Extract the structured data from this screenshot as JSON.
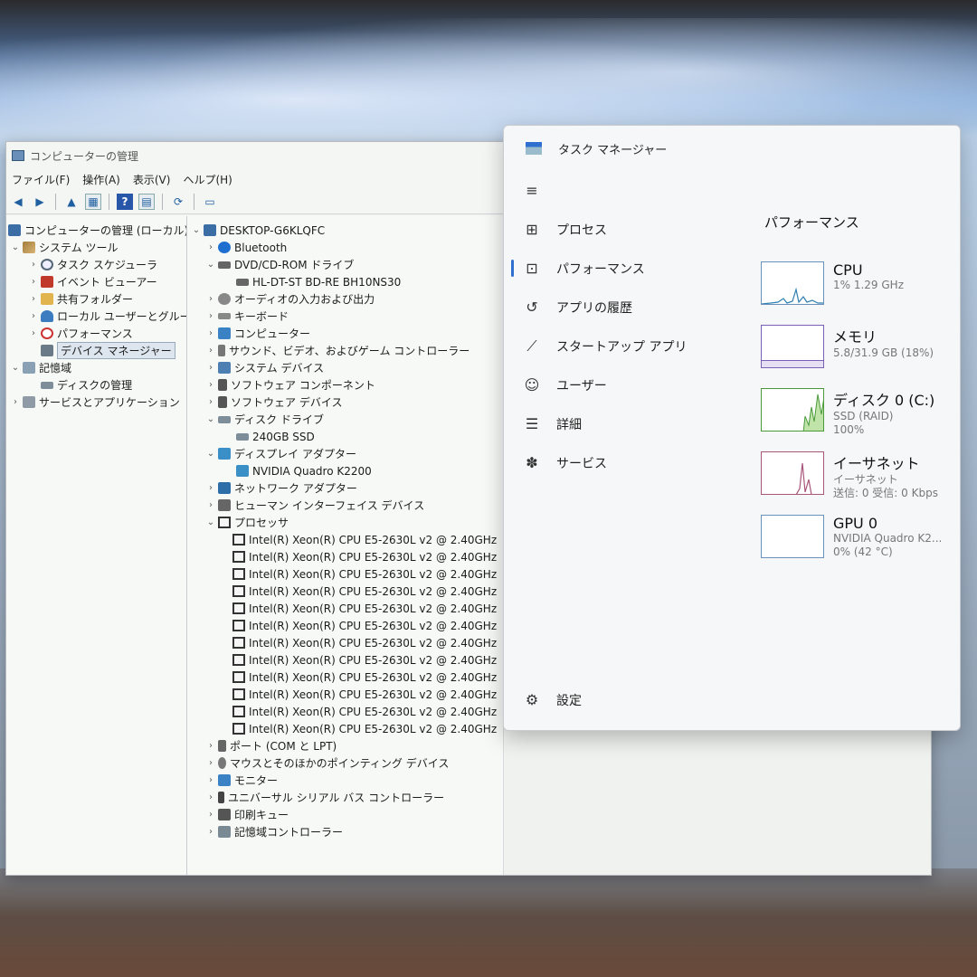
{
  "computer_management": {
    "title": "コンピューターの管理",
    "menu": [
      "ファイル(F)",
      "操作(A)",
      "表示(V)",
      "ヘルプ(H)"
    ],
    "tree": {
      "root": "コンピューターの管理 (ローカル)",
      "system_tools": "システム ツール",
      "task_scheduler": "タスク スケジューラ",
      "event_viewer": "イベント ビューアー",
      "shared_folders": "共有フォルダー",
      "local_users": "ローカル ユーザーとグループ",
      "performance": "パフォーマンス",
      "device_manager": "デバイス マネージャー",
      "storage": "記憶域",
      "disk_management": "ディスクの管理",
      "services_apps": "サービスとアプリケーション"
    },
    "devices": {
      "computer_name": "DESKTOP-G6KLQFC",
      "bluetooth": "Bluetooth",
      "dvd": "DVD/CD-ROM ドライブ",
      "dvd_child": "HL-DT-ST BD-RE  BH10NS30",
      "audio_io": "オーディオの入力および出力",
      "keyboard": "キーボード",
      "computer": "コンピューター",
      "sound": "サウンド、ビデオ、およびゲーム コントローラー",
      "system_devices": "システム デバイス",
      "software_components": "ソフトウェア コンポーネント",
      "software_devices": "ソフトウェア デバイス",
      "disk_drives": "ディスク ドライブ",
      "disk_child": "240GB SSD",
      "display_adapters": "ディスプレイ アダプター",
      "display_child": "NVIDIA Quadro K2200",
      "network_adapters": "ネットワーク アダプター",
      "hid": "ヒューマン インターフェイス デバイス",
      "processors": "プロセッサ",
      "processor_list": [
        "Intel(R) Xeon(R) CPU E5-2630L v2 @ 2.40GHz",
        "Intel(R) Xeon(R) CPU E5-2630L v2 @ 2.40GHz",
        "Intel(R) Xeon(R) CPU E5-2630L v2 @ 2.40GHz",
        "Intel(R) Xeon(R) CPU E5-2630L v2 @ 2.40GHz",
        "Intel(R) Xeon(R) CPU E5-2630L v2 @ 2.40GHz",
        "Intel(R) Xeon(R) CPU E5-2630L v2 @ 2.40GHz",
        "Intel(R) Xeon(R) CPU E5-2630L v2 @ 2.40GHz",
        "Intel(R) Xeon(R) CPU E5-2630L v2 @ 2.40GHz",
        "Intel(R) Xeon(R) CPU E5-2630L v2 @ 2.40GHz",
        "Intel(R) Xeon(R) CPU E5-2630L v2 @ 2.40GHz",
        "Intel(R) Xeon(R) CPU E5-2630L v2 @ 2.40GHz",
        "Intel(R) Xeon(R) CPU E5-2630L v2 @ 2.40GHz"
      ],
      "ports": "ポート (COM と LPT)",
      "mice": "マウスとそのほかのポインティング デバイス",
      "monitors": "モニター",
      "usb": "ユニバーサル シリアル バス コントローラー",
      "print_queue": "印刷キュー",
      "storage_controllers": "記憶域コントローラー"
    }
  },
  "task_manager": {
    "title": "タスク マネージャー",
    "nav": {
      "menu_icon": "hamburger-icon",
      "processes": "プロセス",
      "performance": "パフォーマンス",
      "app_history": "アプリの履歴",
      "startup": "スタートアップ アプリ",
      "users": "ユーザー",
      "details": "詳細",
      "services": "サービス",
      "settings": "設定"
    },
    "heading": "パフォーマンス",
    "cpu": {
      "name": "CPU",
      "line1": "1%  1.29 GHz"
    },
    "memory": {
      "name": "メモリ",
      "line1": "5.8/31.9 GB (18%)",
      "usage_fraction": 0.18
    },
    "disk": {
      "name": "ディスク 0 (C:)",
      "line1": "SSD (RAID)",
      "line2": "100%"
    },
    "ethernet": {
      "name": "イーサネット",
      "line1": "イーサネット",
      "line2": "送信: 0 受信: 0 Kbps"
    },
    "gpu": {
      "name": "GPU 0",
      "line1": "NVIDIA Quadro K2...",
      "line2": "0%  (42 °C)"
    },
    "colors": {
      "cpu": "#6a8fb8",
      "memory": "#7a5fb8",
      "disk": "#4a9a3a",
      "ethernet": "#a8557a",
      "accent": "#2f6fcf"
    }
  }
}
